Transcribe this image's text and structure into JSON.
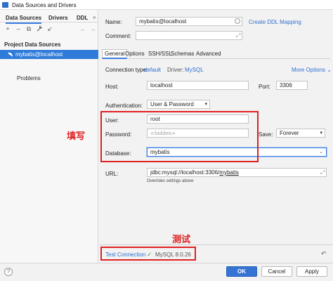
{
  "window": {
    "title": "Data Sources and Drivers"
  },
  "left": {
    "tabs": [
      "Data Sources",
      "Drivers",
      "DDL"
    ],
    "more": "»",
    "toolbar_icons": [
      "+",
      "–",
      "⧉",
      "🔧",
      "↙",
      "←",
      "→"
    ],
    "section": "Project Data Sources",
    "selected_item": "mybatis@localhost",
    "problems": "Problems",
    "help": "?"
  },
  "form": {
    "name_label": "Name:",
    "name_value": "mybatis@localhost",
    "create_ddl": "Create DDL Mapping",
    "comment_label": "Comment:",
    "tabs": [
      "General",
      "Options",
      "SSH/SSL",
      "Schemas",
      "Advanced"
    ],
    "connection_type_label": "Connection type:",
    "connection_type_value": "default",
    "driver_label": "Driver:",
    "driver_value": "MySQL",
    "more_options": "More Options ⌄",
    "host_label": "Host:",
    "host_value": "localhost",
    "port_label": "Port:",
    "port_value": "3306",
    "auth_label": "Authentication:",
    "auth_value": "User & Password",
    "user_label": "User:",
    "user_value": "root",
    "password_label": "Password:",
    "password_placeholder": "<hidden>",
    "save_label": "Save:",
    "save_value": "Forever",
    "database_label": "Database:",
    "database_value": "mybatis",
    "url_label": "URL:",
    "url_prefix": "jdbc:mysql://localhost:3306/",
    "url_db": "mybatis",
    "overrides_note": "Overrides settings above",
    "test_connection": "Test Connection",
    "test_result": "MySQL 8.0.26"
  },
  "annotations": {
    "fill": "填写",
    "test": "测试"
  },
  "buttons": {
    "ok": "OK",
    "cancel": "Cancel",
    "apply": "Apply"
  },
  "colors": {
    "accent": "#3574d4",
    "selection": "#2f7bd9",
    "annotation": "#e02020",
    "success": "#3aa04a"
  }
}
